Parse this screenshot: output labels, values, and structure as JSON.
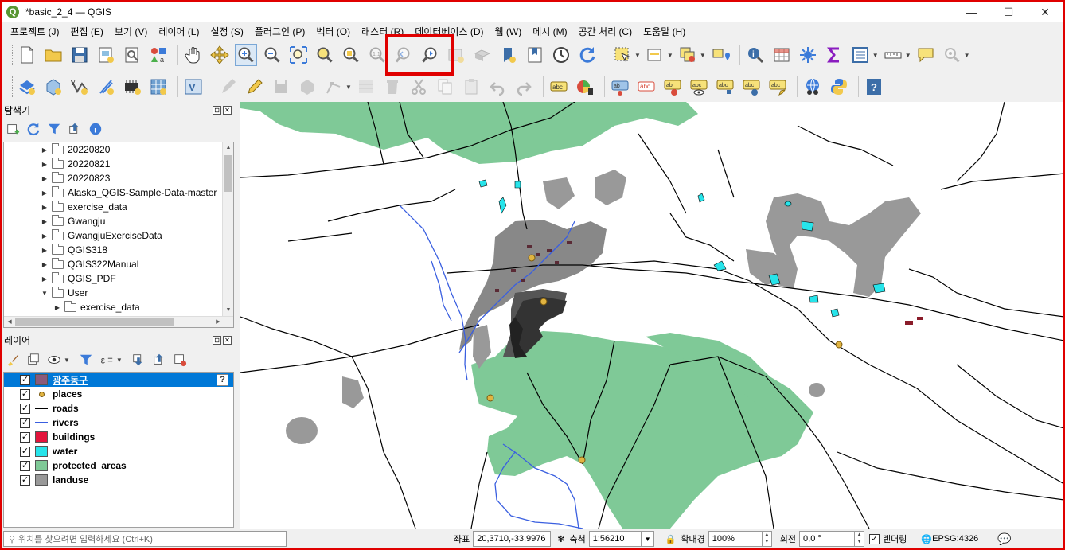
{
  "window": {
    "title": "*basic_2_4 — QGIS",
    "app_icon": "Q",
    "controls": [
      "minimize-icon",
      "maximize-icon",
      "close-icon"
    ]
  },
  "menu": [
    "프로젝트 (J)",
    "편집 (E)",
    "보기 (V)",
    "레이어 (L)",
    "설정 (S)",
    "플러그인 (P)",
    "벡터 (O)",
    "래스터 (R)",
    "데이터베이스 (D)",
    "웹 (W)",
    "메시 (M)",
    "공간 처리 (C)",
    "도움말 (H)"
  ],
  "browser_panel": {
    "title": "탐색기",
    "items": [
      {
        "label": "20220820",
        "indent": 1,
        "expanded": false
      },
      {
        "label": "20220821",
        "indent": 1,
        "expanded": false
      },
      {
        "label": "20220823",
        "indent": 1,
        "expanded": false
      },
      {
        "label": "Alaska_QGIS-Sample-Data-master",
        "indent": 1,
        "expanded": false
      },
      {
        "label": "exercise_data",
        "indent": 1,
        "expanded": false
      },
      {
        "label": "Gwangju",
        "indent": 1,
        "expanded": false
      },
      {
        "label": "GwangjuExerciseData",
        "indent": 1,
        "expanded": false
      },
      {
        "label": "QGIS318",
        "indent": 1,
        "expanded": false
      },
      {
        "label": "QGIS322Manual",
        "indent": 1,
        "expanded": false
      },
      {
        "label": "QGIS_PDF",
        "indent": 1,
        "expanded": false
      },
      {
        "label": "User",
        "indent": 1,
        "expanded": true
      },
      {
        "label": "exercise_data",
        "indent": 2,
        "expanded": false
      }
    ]
  },
  "layers_panel": {
    "title": "레이어",
    "layers": [
      {
        "name": "광주동구",
        "checked": true,
        "symbol": "polygon",
        "color": "#8b5a7a",
        "selected": true
      },
      {
        "name": "places",
        "checked": true,
        "symbol": "point",
        "color": "#e1b441",
        "selected": false
      },
      {
        "name": "roads",
        "checked": true,
        "symbol": "line",
        "color": "#000000",
        "selected": false
      },
      {
        "name": "rivers",
        "checked": true,
        "symbol": "line",
        "color": "#3a5fe0",
        "selected": false
      },
      {
        "name": "buildings",
        "checked": true,
        "symbol": "polygon",
        "color": "#e3143c",
        "selected": false
      },
      {
        "name": "water",
        "checked": true,
        "symbol": "polygon",
        "color": "#27e4ea",
        "selected": false
      },
      {
        "name": "protected_areas",
        "checked": true,
        "symbol": "polygon",
        "color": "#7fc997",
        "selected": false
      },
      {
        "name": "landuse",
        "checked": true,
        "symbol": "polygon",
        "color": "#999999",
        "selected": false
      }
    ]
  },
  "statusbar": {
    "locator_placeholder": "위치를 찾으려면 입력하세요 (Ctrl+K)",
    "coord_label": "좌표",
    "coord_value": "20,3710,-33,9976",
    "scale_label": "축척",
    "scale_value": "1:56210",
    "magnifier_label": "확대경",
    "magnifier_value": "100%",
    "rotation_label": "회전",
    "rotation_value": "0,0 °",
    "render_label": "렌더링",
    "render_checked": true,
    "crs": "EPSG:4326"
  }
}
